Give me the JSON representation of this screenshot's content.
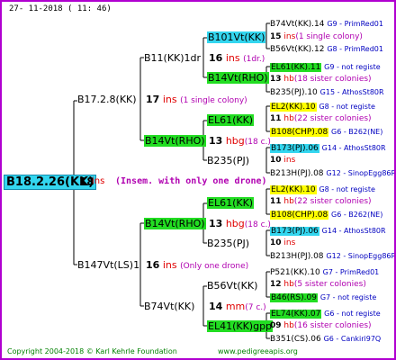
{
  "header": {
    "datestamp": "27- 11-2018 ( 11: 46)"
  },
  "root": {
    "label": "B18.2.26(KK)",
    "number": "18",
    "ins": "ins",
    "note": "(Insem. with only one drone)"
  },
  "gen1": [
    {
      "label": "B17.2.8(KK)",
      "number": "17",
      "ins": "ins",
      "note": "(1 single colony)"
    },
    {
      "label": "B147Vt(LS)1",
      "number": "16",
      "ins": "ins",
      "note": "(Only one drone)"
    }
  ],
  "gen2": [
    {
      "label": "B11(KK)1dr",
      "number": "16",
      "ins": "ins",
      "note": "(1dr.)"
    },
    {
      "label": "B14Vt(RHO)",
      "number": "13",
      "ins": "hbg",
      "note": "(18 c.)"
    },
    {
      "label": "B14Vt(RHO)",
      "number": "13",
      "ins": "hbg",
      "note": "(18 c.)"
    },
    {
      "label": "B74Vt(KK)",
      "number": "14",
      "ins": "mm",
      "note": "(7 c.)"
    }
  ],
  "gen3": [
    {
      "label": "B101Vt(KK)",
      "number": "15",
      "ins": "ins",
      "note": "(1 single colony)"
    },
    {
      "label": "B14Vt(RHO)",
      "number": "",
      "ins": "",
      "note": ""
    },
    {
      "label": "EL61(KK)",
      "number": "13",
      "ins": "hbg",
      "note": "(18 c.)"
    },
    {
      "label": "B235(PJ)",
      "number": "10",
      "ins": "ins",
      "note": ""
    },
    {
      "label": "EL61(KK)",
      "number": "13",
      "ins": "hbg",
      "note": "(18 c.)"
    },
    {
      "label": "B235(PJ)",
      "number": "10",
      "ins": "ins",
      "note": ""
    },
    {
      "label": "B56Vt(KK)",
      "number": "14",
      "ins": "mm",
      "note": "(7 c.)"
    },
    {
      "label": "EL41(KK)gpp",
      "number": "",
      "ins": "",
      "note": ""
    }
  ],
  "gen4": [
    {
      "label": "B74Vt(KK).14",
      "number": "",
      "ins": "",
      "note": "",
      "gdb": "G9 - PrimRed01"
    },
    {
      "label": "",
      "number": "15",
      "ins": "ins",
      "note": "(1 single colony)",
      "gdb": ""
    },
    {
      "label": "B56Vt(KK).12",
      "number": "",
      "ins": "",
      "note": "",
      "gdb": "G8 - PrimRed01"
    },
    {
      "label": "EL61(KK).11",
      "number": "",
      "ins": "",
      "note": "",
      "gdb": "G9 - not registe"
    },
    {
      "label": "",
      "number": "13",
      "ins": "hb",
      "note": "(18 sister colonies)",
      "gdb": ""
    },
    {
      "label": "B235(PJ).10",
      "number": "",
      "ins": "",
      "note": "",
      "gdb": "G15 - AthosSt80R"
    },
    {
      "label": "EL2(KK).10",
      "number": "",
      "ins": "",
      "note": "",
      "gdb": "G8 - not registe"
    },
    {
      "label": "",
      "number": "11",
      "ins": "hb",
      "note": "(22 sister colonies)",
      "gdb": ""
    },
    {
      "label": "B108(CHP).08",
      "number": "",
      "ins": "",
      "note": "",
      "gdb": "G6 - B262(NE)"
    },
    {
      "label": "B173(PJ).06",
      "number": "",
      "ins": "",
      "note": "",
      "gdb": "G14 - AthosSt80R"
    },
    {
      "label": "",
      "number": "10",
      "ins": "ins",
      "note": "",
      "gdb": ""
    },
    {
      "label": "B213H(PJ).08",
      "number": "",
      "ins": "",
      "note": "",
      "gdb": "G12 - SinopEgg86R"
    },
    {
      "label": "EL2(KK).10",
      "number": "",
      "ins": "",
      "note": "",
      "gdb": "G8 - not registe"
    },
    {
      "label": "",
      "number": "11",
      "ins": "hb",
      "note": "(22 sister colonies)",
      "gdb": ""
    },
    {
      "label": "B108(CHP).08",
      "number": "",
      "ins": "",
      "note": "",
      "gdb": "G6 - B262(NE)"
    },
    {
      "label": "B173(PJ).06",
      "number": "",
      "ins": "",
      "note": "",
      "gdb": "G14 - AthosSt80R"
    },
    {
      "label": "",
      "number": "10",
      "ins": "ins",
      "note": "",
      "gdb": ""
    },
    {
      "label": "B213H(PJ).08",
      "number": "",
      "ins": "",
      "note": "",
      "gdb": "G12 - SinopEgg86R"
    },
    {
      "label": "P521(KK).10",
      "number": "",
      "ins": "",
      "note": "",
      "gdb": "G7 - PrimRed01"
    },
    {
      "label": "",
      "number": "12",
      "ins": "hb",
      "note": "(5 sister colonies)",
      "gdb": ""
    },
    {
      "label": "B46(RS).09",
      "number": "",
      "ins": "",
      "note": "",
      "gdb": "G7 - not registe"
    },
    {
      "label": "EL74(KK).07",
      "number": "",
      "ins": "",
      "note": "",
      "gdb": "G6 - not registe"
    },
    {
      "label": "",
      "number": "09",
      "ins": "hb",
      "note": "(16 sister colonies)",
      "gdb": ""
    },
    {
      "label": "B351(CS).06",
      "number": "",
      "ins": "",
      "note": "",
      "gdb": "G6 - Cankiri97Q"
    }
  ],
  "footer": {
    "copyright": "Copyright 2004-2018 © Karl Kehrle Foundation",
    "site": "www.pedigreeapis.org"
  }
}
